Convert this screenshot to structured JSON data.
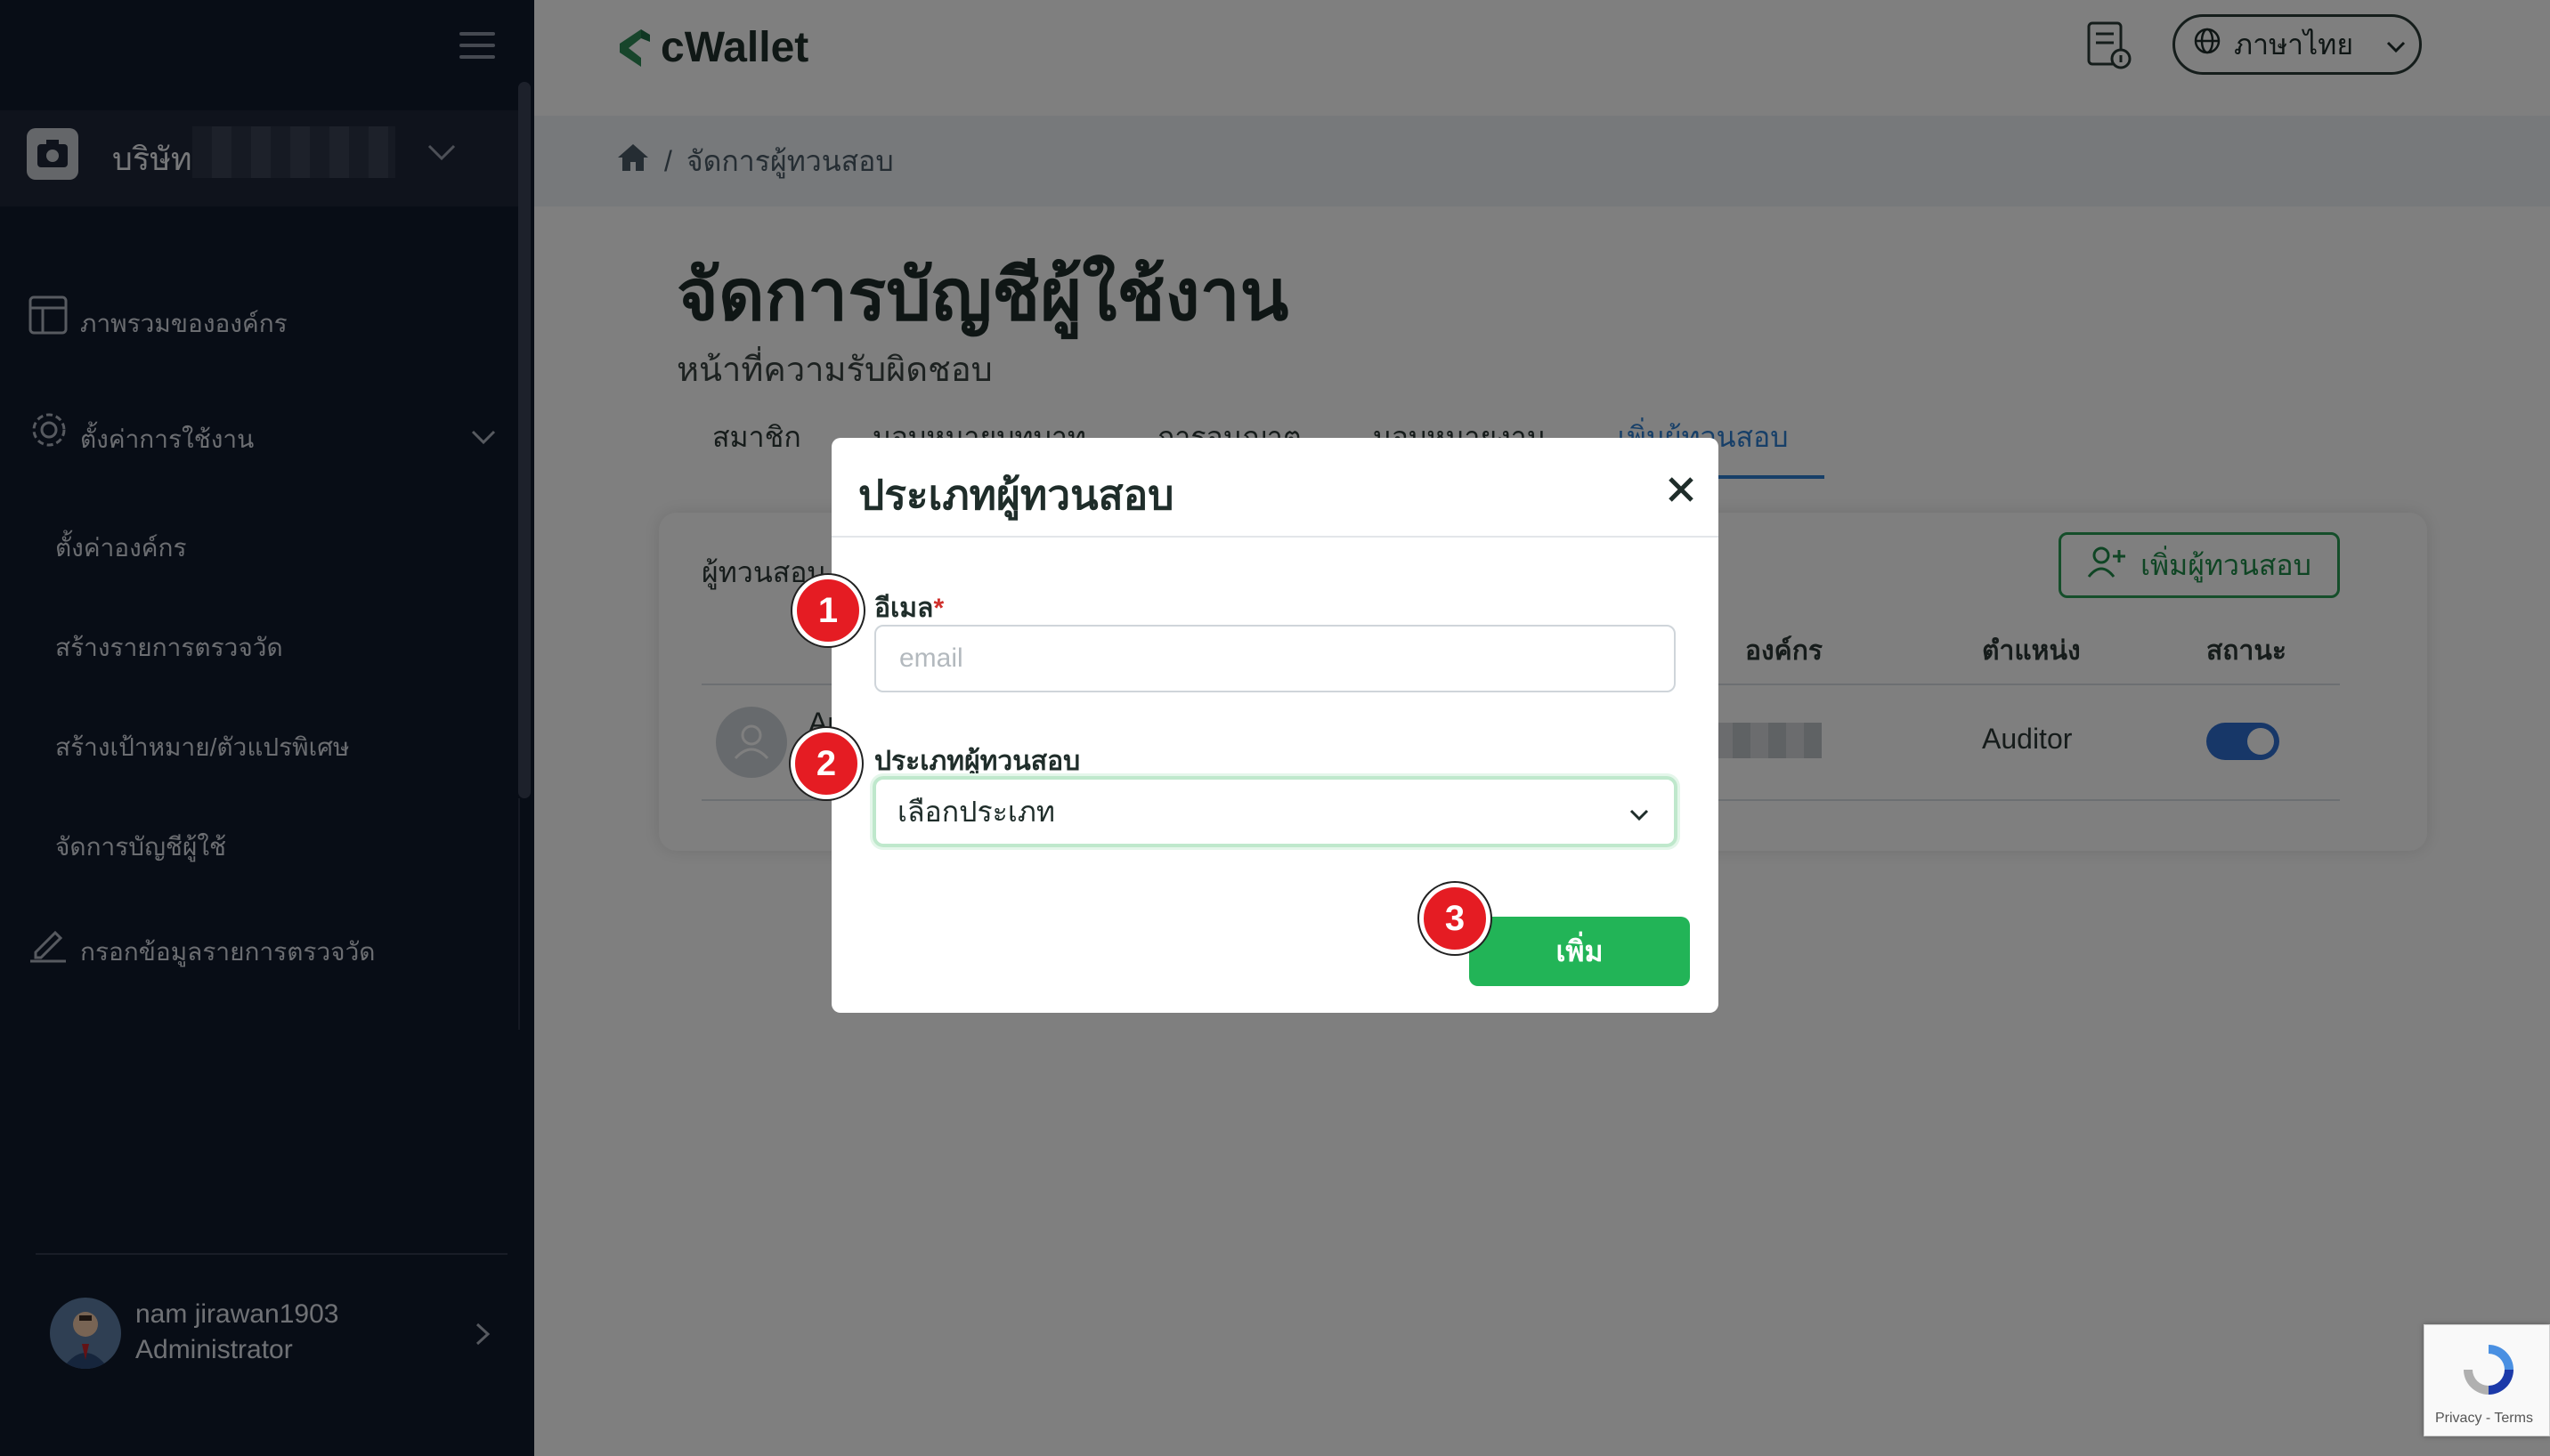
{
  "sidebar": {
    "company_label": "บริษัท",
    "nav": [
      {
        "label": "ภาพรวมขององค์กร"
      },
      {
        "label": "ตั้งค่าการใช้งาน"
      },
      {
        "label": "กรอกข้อมูลรายการตรวจวัด"
      }
    ],
    "submenu": [
      {
        "label": "ตั้งค่าองค์กร"
      },
      {
        "label": "สร้างรายการตรวจวัด"
      },
      {
        "label": "สร้างเป้าหมาย/ตัวแปรพิเศษ"
      },
      {
        "label": "จัดการบัญชีผู้ใช้"
      }
    ],
    "user": {
      "name": "nam jirawan1903",
      "role": "Administrator"
    }
  },
  "header": {
    "brand": "cWallet",
    "language": "ภาษาไทย"
  },
  "breadcrumb": {
    "sep": "/",
    "current": "จัดการผู้ทวนสอบ"
  },
  "page": {
    "title": "จัดการบัญชีผู้ใช้งาน",
    "subtitle": "หน้าที่ความรับผิดชอบ",
    "tabs": [
      {
        "label": "สมาชิก"
      },
      {
        "label": "มอบหมายบทบาท"
      },
      {
        "label": "การอนุญาต"
      },
      {
        "label": "มอบหมายงาน"
      },
      {
        "label": "เพิ่มผู้ทวนสอบ",
        "active": true
      }
    ]
  },
  "card": {
    "label": "ผู้ทวนสอบ",
    "add_button": "เพิ่มผู้ทวนสอบ",
    "columns": [
      "องค์กร",
      "ตำแหน่ง",
      "สถานะ"
    ],
    "row": {
      "name": "Au",
      "position": "Auditor",
      "status_on": true
    }
  },
  "modal": {
    "title": "ประเภทผู้ทวนสอบ",
    "email_label": "อีเมล",
    "required_mark": "*",
    "email_placeholder": "email",
    "email_value": "",
    "type_label": "ประเภทผู้ทวนสอบ",
    "type_selected": "เลือกประเภท",
    "submit": "เพิ่ม"
  },
  "steps": [
    "1",
    "2",
    "3"
  ],
  "recaptcha": {
    "text": "Privacy - Terms"
  },
  "colors": {
    "sidebar_bg": "#111a2d",
    "accent_green": "#22b457",
    "active_tab": "#2f7fd0",
    "step_badge": "#e51c23"
  }
}
